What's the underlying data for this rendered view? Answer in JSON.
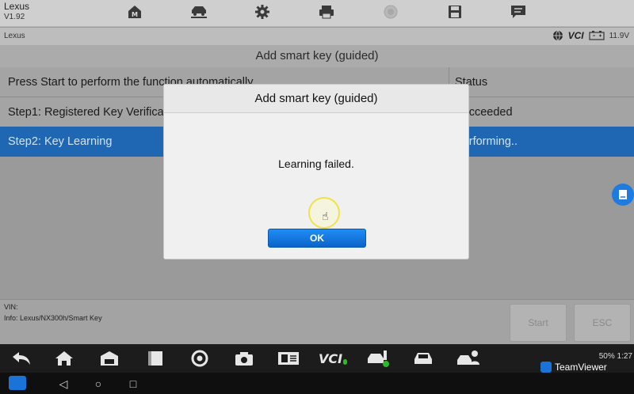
{
  "app": {
    "name": "Lexus",
    "version": "V1.92"
  },
  "toolbar": {
    "items": [
      {
        "icon": "home-m-icon"
      },
      {
        "icon": "vehicle-lift-icon"
      },
      {
        "icon": "settings-gear-icon"
      },
      {
        "icon": "print-icon"
      },
      {
        "icon": "record-icon"
      },
      {
        "icon": "save-icon"
      },
      {
        "icon": "message-icon"
      }
    ]
  },
  "statusbar": {
    "make": "Lexus",
    "vci": "VCI",
    "voltage": "11.9V"
  },
  "page": {
    "title": "Add smart key (guided)"
  },
  "table": {
    "header_left": "Press Start to perform the function automatically.",
    "header_right": "Status",
    "rows": [
      {
        "label": "Step1: Registered Key Verification",
        "status": "Succeeded"
      },
      {
        "label": "Step2: Key Learning",
        "status": "Performing.."
      }
    ]
  },
  "bottom": {
    "vin": "VIN:",
    "info": "Info: Lexus/NX300h/Smart Key",
    "start_label": "Start",
    "esc_label": "ESC"
  },
  "dialog": {
    "title": "Add smart key (guided)",
    "message": "Learning failed.",
    "ok_label": "OK"
  },
  "dock": {
    "items": [
      "back-icon",
      "home-icon",
      "garage-icon",
      "notes-icon",
      "chrome-icon",
      "camera-icon",
      "scan-icon",
      "vci-icon",
      "vehicle-tools-icon",
      "car-icon",
      "user-car-icon"
    ],
    "vci_text": "VCI",
    "status": "50% 1:27"
  },
  "teamviewer": {
    "label": "TeamViewer"
  },
  "colors": {
    "accent": "#1f66b3",
    "ok_button": "#1576e0",
    "highlight_text": "#d4e4f6"
  }
}
